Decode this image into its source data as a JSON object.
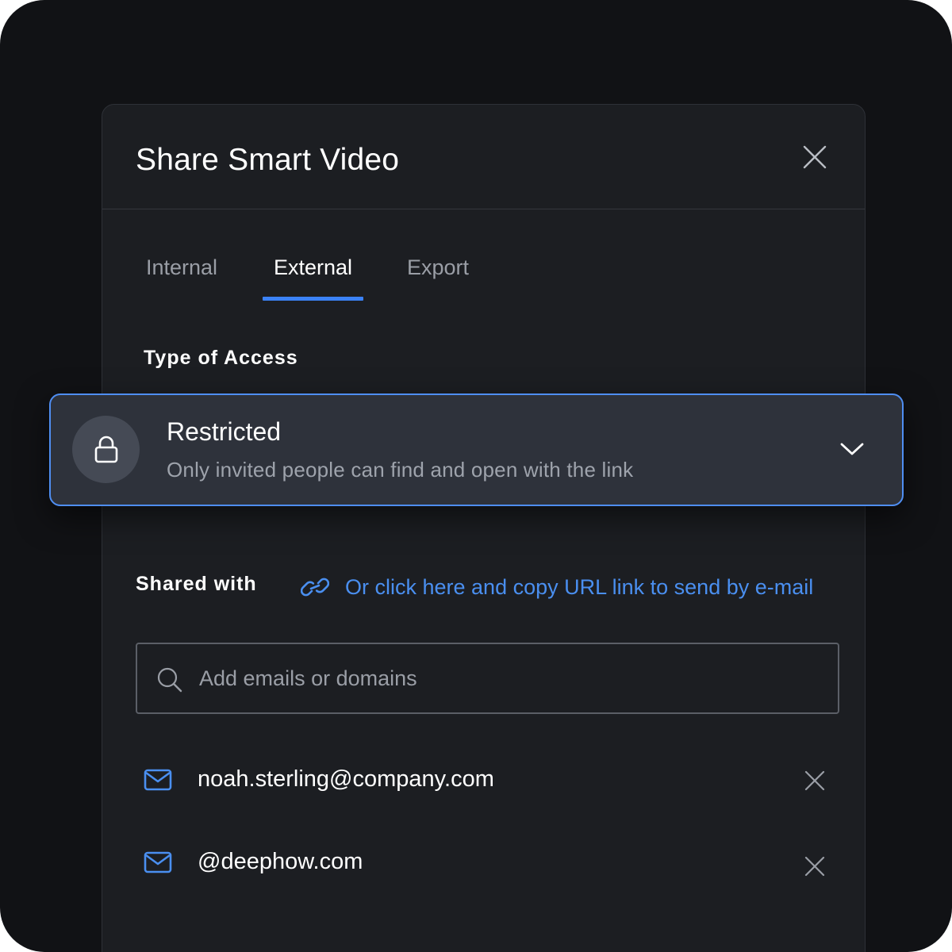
{
  "dialog": {
    "title": "Share Smart Video"
  },
  "tabs": [
    {
      "label": "Internal",
      "active": false
    },
    {
      "label": "External",
      "active": true
    },
    {
      "label": "Export",
      "active": false
    }
  ],
  "access": {
    "section_label": "Type of Access",
    "selected_title": "Restricted",
    "selected_description": "Only invited people can find and open with the link",
    "icon": "lock-icon"
  },
  "shared": {
    "section_label": "Shared with",
    "copy_link_text": "Or click here and copy URL link to send by e-mail",
    "search_placeholder": "Add emails or domains",
    "items": [
      {
        "value": "noah.sterling@company.com",
        "icon": "mail-icon"
      },
      {
        "value": "@deephow.com",
        "icon": "mail-icon"
      }
    ]
  },
  "colors": {
    "accent": "#3b82f6",
    "link": "#4a8ff0",
    "dialog_bg": "#1c1e22",
    "page_bg": "#111215"
  }
}
